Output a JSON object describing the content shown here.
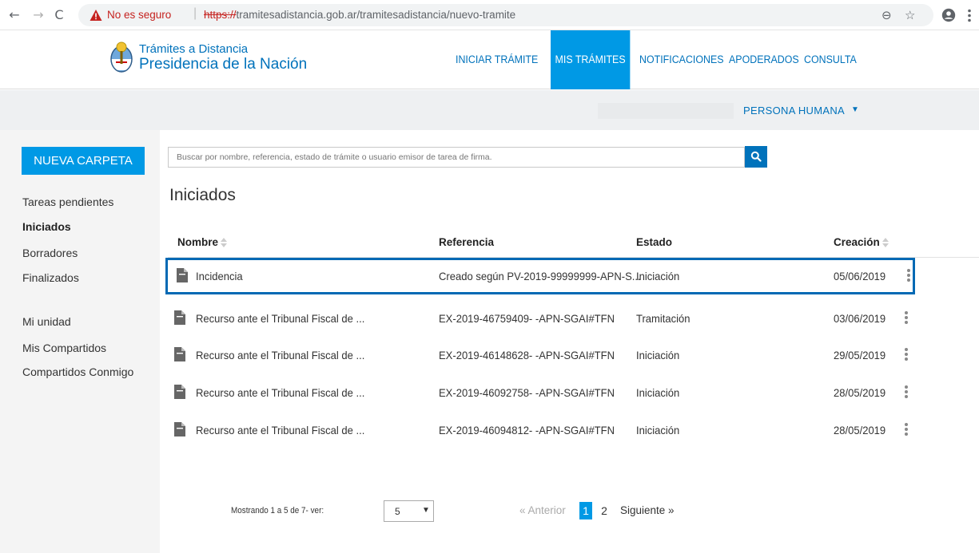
{
  "browser": {
    "security_label": "No es seguro",
    "url_scheme": "https://",
    "url_rest": "tramitesadistancia.gob.ar/tramitesadistancia/nuevo-tramite",
    "icons": [
      "back-arrow-icon",
      "forward-arrow-icon",
      "reload-icon",
      "warning-icon",
      "zoom-icon",
      "star-icon",
      "account-icon",
      "menu-dots-icon"
    ],
    "warning_color": "#c5221f"
  },
  "header": {
    "logo_line1": "Trámites a Distancia",
    "logo_line2": "Presidencia de la Nación",
    "nav": [
      {
        "label": "INICIAR TRÁMITE",
        "active": false
      },
      {
        "label": "MIS TRÁMITES",
        "active": true
      },
      {
        "label": "NOTIFICACIONES",
        "active": false
      },
      {
        "label": "APODERADOS",
        "active": false
      },
      {
        "label": "CONSULTA",
        "active": false
      }
    ],
    "brand_color": "#0072bb",
    "active_color": "#0099e5"
  },
  "subheader": {
    "persona_label": "PERSONA HUMANA"
  },
  "sidebar": {
    "new_folder_label": "NUEVA CARPETA",
    "items": [
      {
        "label": "Tareas pendientes",
        "active": false
      },
      {
        "label": "Iniciados",
        "active": true
      },
      {
        "label": "Borradores",
        "active": false
      },
      {
        "label": "Finalizados",
        "active": false
      },
      {
        "label": "Mi unidad",
        "active": false
      },
      {
        "label": "Mis Compartidos",
        "active": false
      },
      {
        "label": "Compartidos Conmigo",
        "active": false
      }
    ]
  },
  "search": {
    "placeholder": "Buscar por nombre, referencia, estado de trámite o usuario emisor de tarea de firma."
  },
  "main": {
    "title": "Iniciados",
    "columns": {
      "nombre": "Nombre",
      "referencia": "Referencia",
      "estado": "Estado",
      "creacion": "Creación"
    },
    "rows": [
      {
        "nombre": "Incidencia",
        "referencia": "Creado según PV-2019-99999999-APN-S...",
        "estado": "Iniciación",
        "creacion": "05/06/2019",
        "highlighted": true
      },
      {
        "nombre": "Recurso ante el Tribunal Fiscal de ...",
        "referencia": "EX-2019-46759409- -APN-SGAI#TFN",
        "estado": "Tramitación",
        "creacion": "03/06/2019",
        "highlighted": false
      },
      {
        "nombre": "Recurso ante el Tribunal Fiscal de ...",
        "referencia": "EX-2019-46148628- -APN-SGAI#TFN",
        "estado": "Iniciación",
        "creacion": "29/05/2019",
        "highlighted": false
      },
      {
        "nombre": "Recurso ante el Tribunal Fiscal de ...",
        "referencia": "EX-2019-46092758- -APN-SGAI#TFN",
        "estado": "Iniciación",
        "creacion": "28/05/2019",
        "highlighted": false
      },
      {
        "nombre": "Recurso ante el Tribunal Fiscal de ...",
        "referencia": "EX-2019-46094812- -APN-SGAI#TFN",
        "estado": "Iniciación",
        "creacion": "28/05/2019",
        "highlighted": false
      }
    ],
    "highlight_color": "#0069b4"
  },
  "pagination": {
    "showing": "Mostrando 1 a 5 de 7- ver:",
    "page_size": "5",
    "prev": "« Anterior",
    "pages": [
      "1",
      "2"
    ],
    "current_page": "1",
    "next": "Siguiente »"
  }
}
